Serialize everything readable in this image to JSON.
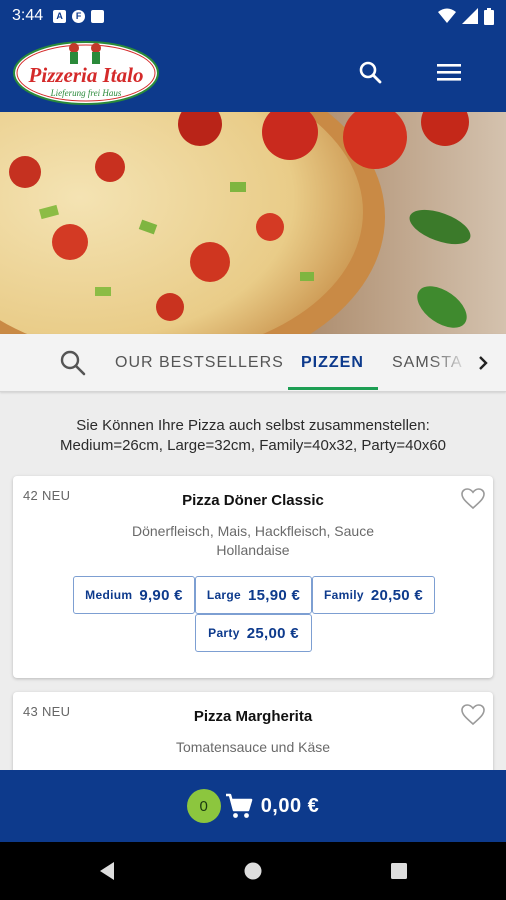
{
  "status_bar": {
    "time": "3:44"
  },
  "header": {
    "logo_text": "Pizzeria Italo",
    "logo_tagline": "Lieferung frei Haus",
    "search_icon": "search-icon",
    "menu_icon": "hamburger-menu-icon",
    "background": "#0d3a8c"
  },
  "tabs": {
    "items": [
      {
        "label": "OUR BESTSELLERS",
        "active": false
      },
      {
        "label": "PIZZEN",
        "active": true
      },
      {
        "label": "SAMSTA",
        "active": false
      }
    ],
    "accent": "#1d9e53"
  },
  "info_text": {
    "line1": "Sie Können Ihre Pizza auch selbst zusammenstellen:",
    "line2": "Medium=26cm, Large=32cm, Family=40x32, Party=40x60"
  },
  "products": [
    {
      "number": "42 NEU",
      "name": "Pizza Döner Classic",
      "description_line1": "Dönerfleisch, Mais, Hackfleisch, Sauce",
      "description_line2": "Hollandaise",
      "prices": [
        {
          "size": "Medium",
          "price": "9,90 €"
        },
        {
          "size": "Large",
          "price": "15,90 €"
        },
        {
          "size": "Family",
          "price": "20,50 €"
        },
        {
          "size": "Party",
          "price": "25,00 €"
        }
      ]
    },
    {
      "number": "43 NEU",
      "name": "Pizza Margherita",
      "description_line1": "Tomatensauce und Käse"
    }
  ],
  "cart": {
    "count": "0",
    "total": "0,00 €",
    "badge_color": "#8cc63e"
  }
}
